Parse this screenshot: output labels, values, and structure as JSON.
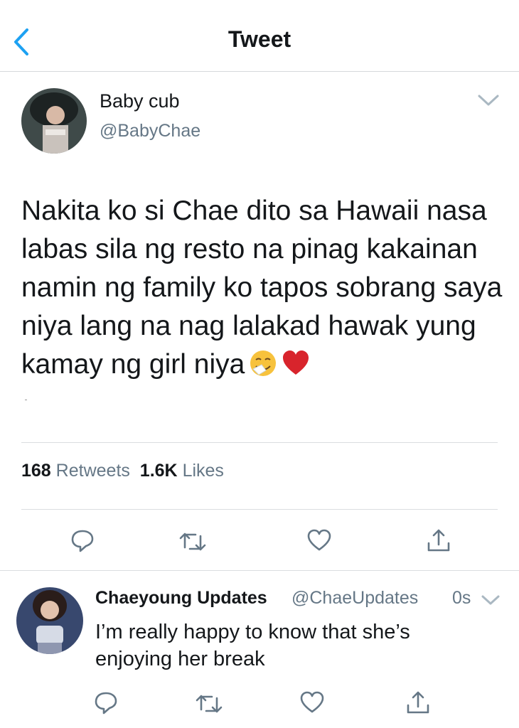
{
  "nav": {
    "title": "Tweet"
  },
  "tweet": {
    "author_name": "Baby cub",
    "author_handle": "@BabyChae",
    "text": "Nakita ko si Chae dito sa Hawaii nasa labas sila ng resto na pinag kakainan namin ng family ko tapos sobrang saya niya lang na nag lalakad hawak yung kamay ng girl niya",
    "emojis": [
      "sneezing-face",
      "red-heart"
    ],
    "retweets_count": "168",
    "retweets_label": "Retweets",
    "likes_count": "1.6K",
    "likes_label": "Likes"
  },
  "reply": {
    "author_name": "Chaeyoung Updates",
    "author_handle": "@ChaeUpdates",
    "time": "0s",
    "text": "I’m really happy to know that she’s enjoying her break"
  },
  "colors": {
    "accent": "#1da1f2",
    "secondary_text": "#657786",
    "divider": "#dadde0",
    "heart": "#e0244b"
  }
}
